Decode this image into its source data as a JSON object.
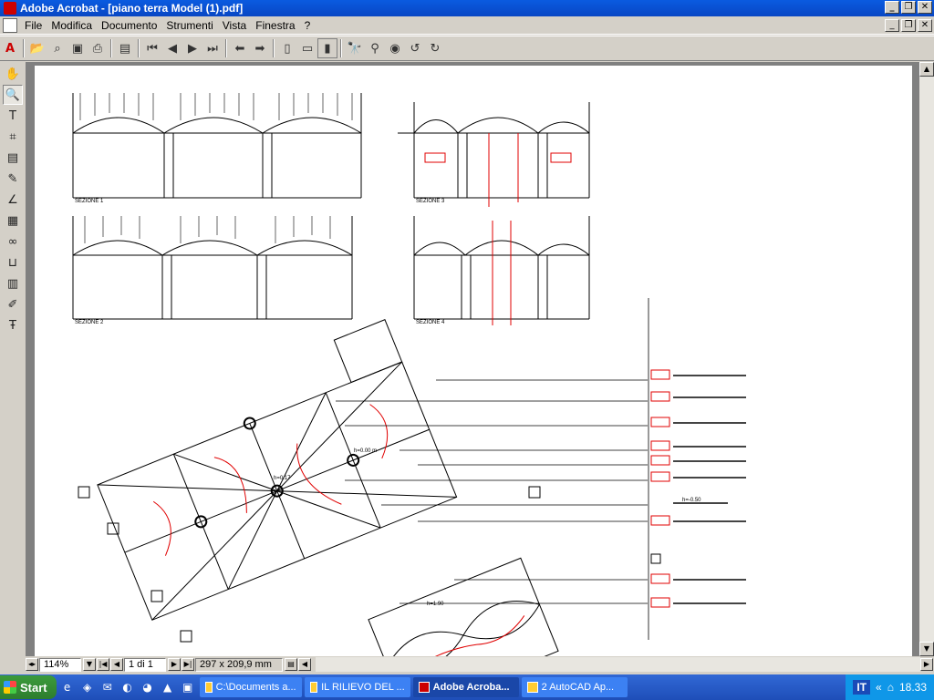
{
  "window": {
    "title": "Adobe Acrobat - [piano terra Model (1).pdf]"
  },
  "menu": [
    "File",
    "Modifica",
    "Documento",
    "Strumenti",
    "Vista",
    "Finestra",
    "?"
  ],
  "status": {
    "zoom": "114%",
    "page": "1 di 1",
    "page_size": "297 x 209,9 mm"
  },
  "drawing": {
    "sections": [
      "SEZIONE 1",
      "SEZIONE 2",
      "SEZIONE 3",
      "SEZIONE 4"
    ],
    "heights": [
      "h=0.00 m",
      "h=0.17",
      "h=-0.50",
      "h=1.90"
    ]
  },
  "taskbar": {
    "start": "Start",
    "tasks": [
      "C:\\Documents a...",
      "IL RILIEVO DEL ...",
      "Adobe Acroba...",
      "2 AutoCAD Ap..."
    ],
    "lang": "IT",
    "clock": "18.33"
  },
  "colors": {
    "titlebar": "#0a5be0",
    "taskbar": "#3168d5",
    "tray": "#0f97e8",
    "annotation_red": "#e00000"
  }
}
